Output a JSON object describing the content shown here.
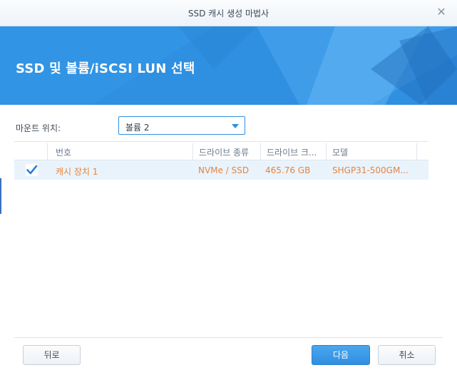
{
  "window": {
    "title": "SSD 캐시 생성 마법사",
    "close_icon": "close-icon"
  },
  "banner": {
    "title": "SSD 및 볼륨/iSCSI LUN 선택",
    "background_color": "#2f8fe0"
  },
  "mount": {
    "label": "마운트 위치:",
    "selected": "볼륨 2"
  },
  "table": {
    "columns": [
      "번호",
      "드라이브 종류",
      "드라이브 크...",
      "모델"
    ],
    "rows": [
      {
        "checked": true,
        "number": "캐시 장치 1",
        "drive_type": "NVMe / SSD",
        "drive_size": "465.76 GB",
        "model": "SHGP31-500GM..."
      }
    ],
    "row_text_color": "#e8843d"
  },
  "footer": {
    "back_label": "뒤로",
    "next_label": "다음",
    "cancel_label": "취소"
  }
}
